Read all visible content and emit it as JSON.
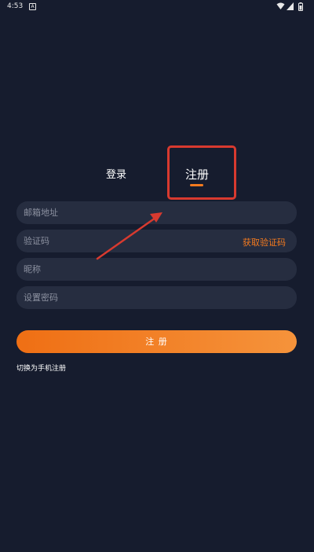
{
  "status_bar": {
    "time": "4:53",
    "notification_icon": "app-notification-icon",
    "wifi_icon": "wifi-icon",
    "signal_icon": "signal-icon",
    "battery_icon": "battery-icon"
  },
  "tabs": {
    "login_label": "登录",
    "register_label": "注册",
    "active": "register"
  },
  "form": {
    "email_placeholder": "邮箱地址",
    "code_placeholder": "验证码",
    "get_code_label": "获取验证码",
    "nickname_placeholder": "昵称",
    "password_placeholder": "设置密码"
  },
  "submit_label": "注 册",
  "switch_label": "切换为手机注册",
  "colors": {
    "background": "#161c2e",
    "field": "#262d40",
    "accent": "#f47a1f",
    "annotation": "#d83a2f"
  }
}
